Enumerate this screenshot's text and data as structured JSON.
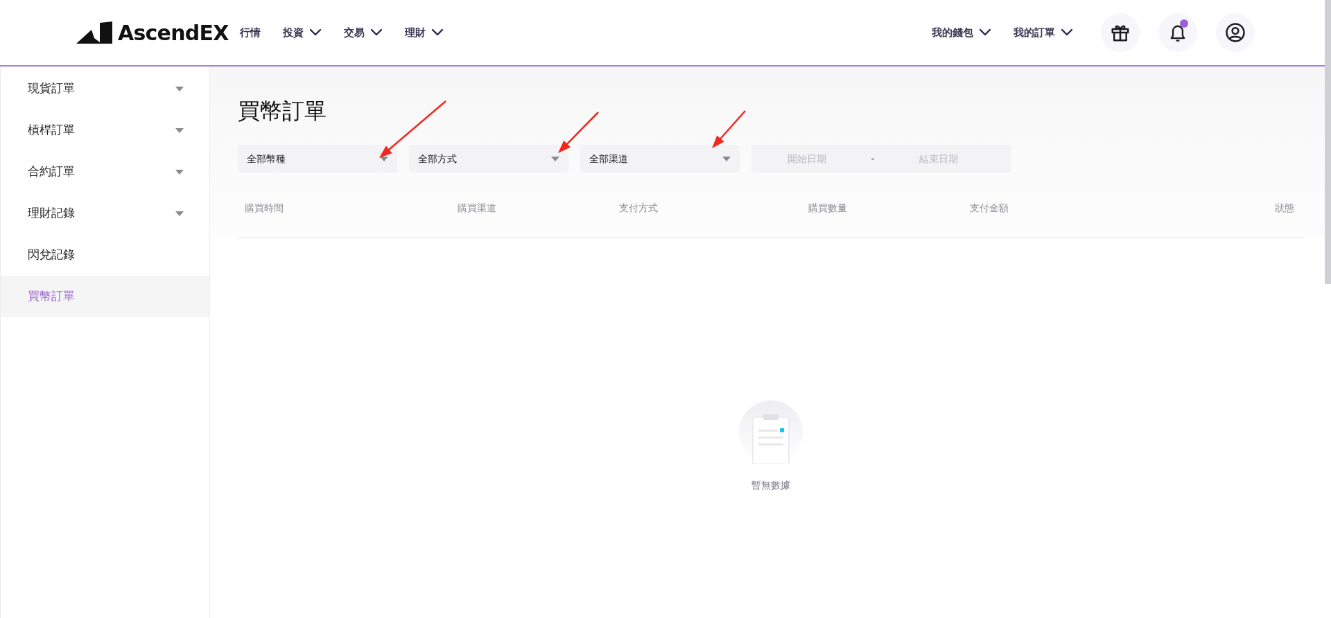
{
  "header": {
    "logo": "AscendEX",
    "nav": [
      {
        "label": "行情",
        "dropdown": false
      },
      {
        "label": "投資",
        "dropdown": true
      },
      {
        "label": "交易",
        "dropdown": true
      },
      {
        "label": "理財",
        "dropdown": true
      }
    ],
    "right_nav": [
      {
        "label": "我的錢包",
        "dropdown": true
      },
      {
        "label": "我的訂單",
        "dropdown": true
      }
    ],
    "notification_unread": true
  },
  "sidebar": {
    "items": [
      {
        "label": "現貨訂單",
        "expandable": true,
        "selected": false
      },
      {
        "label": "槓桿訂單",
        "expandable": true,
        "selected": false
      },
      {
        "label": "合約訂單",
        "expandable": true,
        "selected": false
      },
      {
        "label": "理財記錄",
        "expandable": true,
        "selected": false
      },
      {
        "label": "閃兌記錄",
        "expandable": false,
        "selected": false
      },
      {
        "label": "買幣訂單",
        "expandable": false,
        "selected": true
      }
    ]
  },
  "page_title": "買幣訂單",
  "filters": [
    {
      "kind": "select",
      "value": "全部幣種"
    },
    {
      "kind": "select",
      "value": "全部方式"
    },
    {
      "kind": "select",
      "value": "全部渠道"
    },
    {
      "kind": "daterange",
      "start_placeholder": "開始日期",
      "separator": "-",
      "end_placeholder": "結束日期"
    }
  ],
  "table": {
    "columns": [
      "購買時間",
      "購買渠道",
      "支付方式",
      "購買數量",
      "支付金額",
      "狀態"
    ]
  },
  "empty_state": {
    "message": "暫無數據"
  }
}
